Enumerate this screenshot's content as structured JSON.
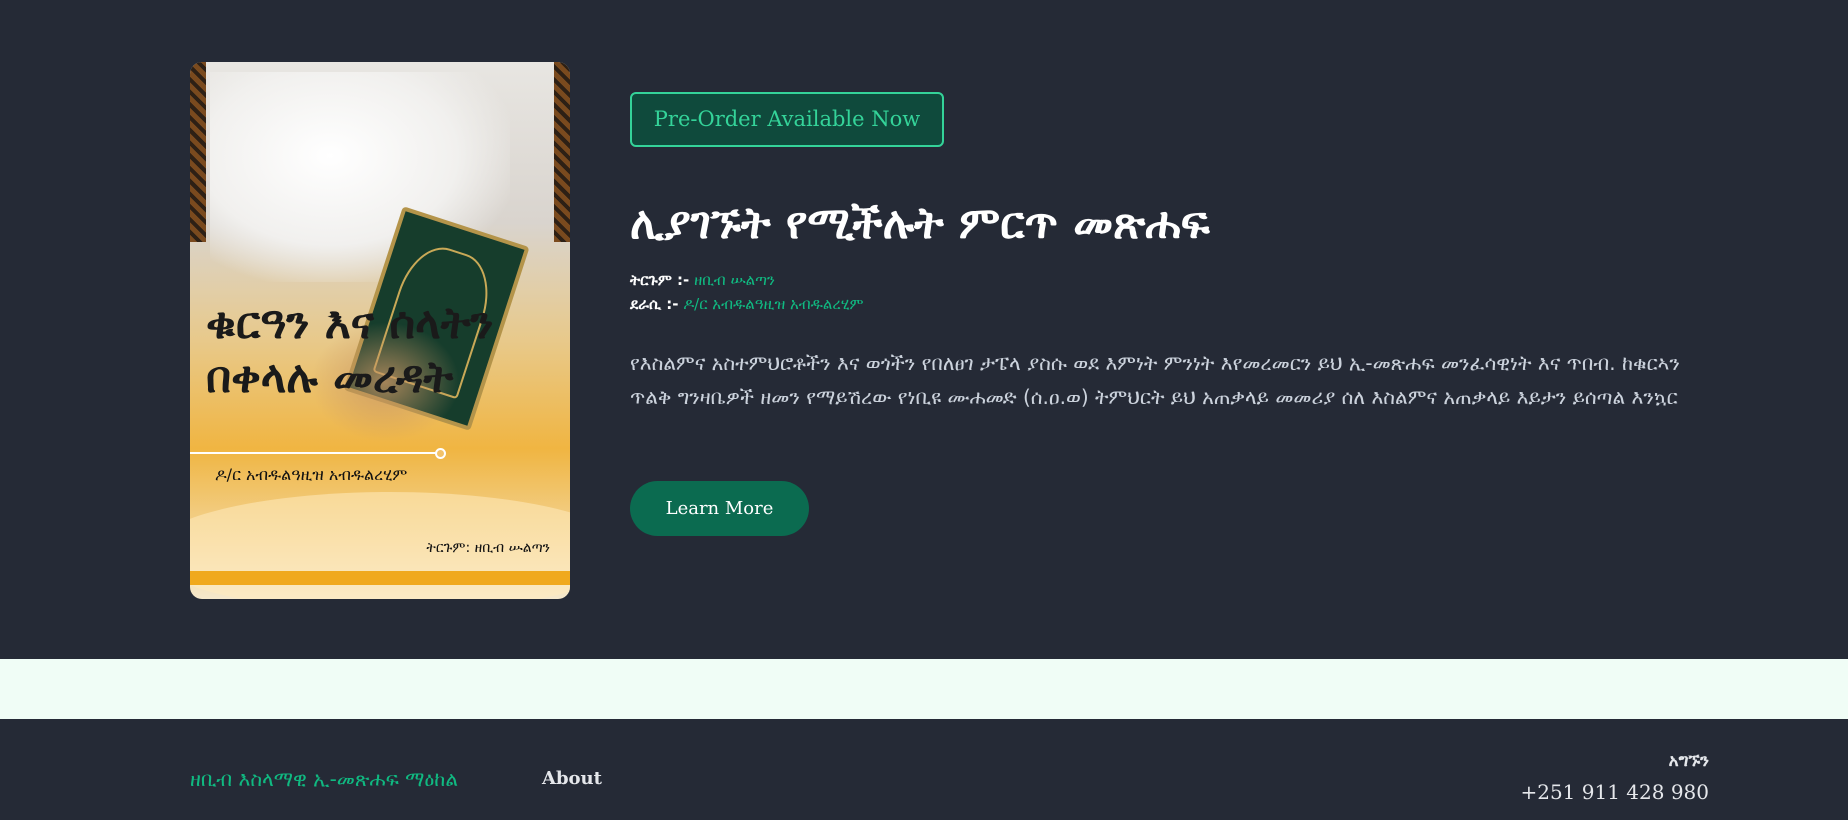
{
  "hero": {
    "cover": {
      "title": "ቁርዓን እና ሰላትን በቀላሉ መረዳት",
      "author": "ዶ/ር አብዱልዓዚዝ አብዱልረሂም",
      "translator": "ትርጉም: ዘቢብ ሡልጣን"
    },
    "badge": "Pre-Order Available Now",
    "headline": "ሊያገኙት የሚችሉት ምርጥ መጽሐፍ",
    "translation_label": "ትርጉም :-",
    "translation_value": "ዘቢብ ሡልጣን",
    "author_label": "ደራሲ :-",
    "author_value": "ዶ/ር አብዱልዓዚዝ አብዱልረሂም",
    "description": "የእስልምና አስተምህሮቶችን እና ወጎችን የበለፀገ ታፔላ ያስሱ ወደ እምነት ምንነት እየመረመርን ይህ ኢ-መጽሐፍ መንፈሳዊነት እና ጥበብ. ከቁርኣን ጥልቅ ግንዛቤዎች ዘመን የማይሽረው የነቢዩ ሙሐመድ (ሰ.ዐ.ወ) ትምህርት ይህ አጠቃላይ መመሪያ ሰለ እስልምና አጠቃላይ እይታን ይሰጣል እንኳር",
    "cta_label": "Learn More"
  },
  "footer": {
    "brand": "ዘቢብ እስላማዊ ኢ-መጽሐፍ ማዕከል",
    "about_label": "About",
    "contact_label": "አግኙን",
    "phone": "+251 911 428 980"
  },
  "colors": {
    "background_dark": "#252a36",
    "accent_green": "#10b981",
    "badge_border": "#34d399",
    "button_green": "#0b6b50",
    "strip": "#f0fdf6"
  }
}
